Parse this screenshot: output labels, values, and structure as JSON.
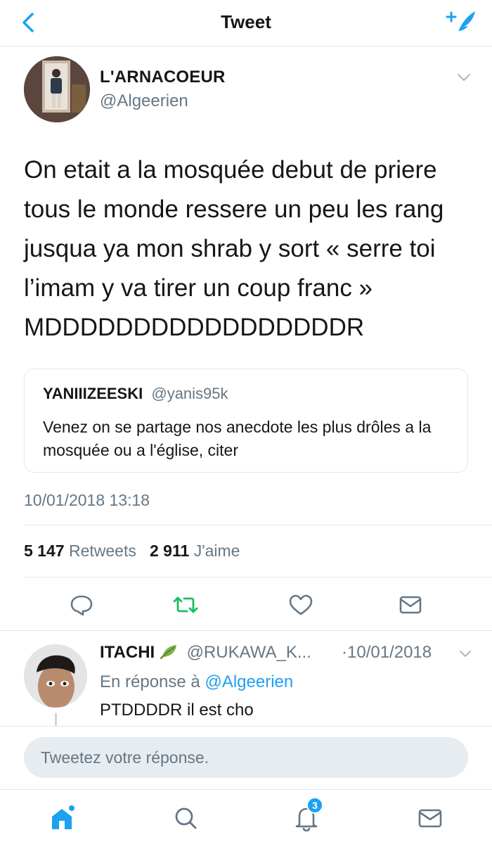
{
  "header": {
    "title": "Tweet",
    "back_icon": "chevron-left-icon",
    "compose_icon": "compose-tweet-icon",
    "accent_color": "#1da1f2"
  },
  "tweet": {
    "author": {
      "name": "L'ARNACOEUR",
      "handle": "@Algeerien"
    },
    "text_lines": [
      "On etait a la mosquée debut de priere",
      "tous le monde ressere un peu les rang",
      "jusqua ya mon shrab y sort « serre toi",
      "l’imam y va tirer un coup franc »",
      "MDDDDDDDDDDDDDDDDDR"
    ],
    "quoted": {
      "name": "YANIIIZEESKI",
      "handle": "@yanis95k",
      "text": "Venez on se partage nos anecdote les plus drôles a la mosquée ou a l'église, citer"
    },
    "timestamp": "10/01/2018 13:18",
    "stats": {
      "retweets_count": "5 147",
      "retweets_label": "Retweets",
      "likes_count": "2 911",
      "likes_label": "J'aime"
    }
  },
  "actions": [
    {
      "icon": "reply-icon"
    },
    {
      "icon": "retweet-icon",
      "color": "#17bf63"
    },
    {
      "icon": "like-icon"
    },
    {
      "icon": "direct-message-icon"
    }
  ],
  "reply": {
    "name": "ITACHI",
    "handle": "@RUKAWA_K...",
    "date": "·10/01/2018",
    "in_reply_prefix": "En réponse à",
    "in_reply_mention": "@Algeerien",
    "text": "PTDDDDR il est cho"
  },
  "composer": {
    "placeholder": "Tweetez votre réponse."
  },
  "tabbar": {
    "items": [
      {
        "icon": "home-icon",
        "active": true
      },
      {
        "icon": "search-icon"
      },
      {
        "icon": "notifications-icon",
        "badge": "3"
      },
      {
        "icon": "messages-icon"
      }
    ]
  }
}
